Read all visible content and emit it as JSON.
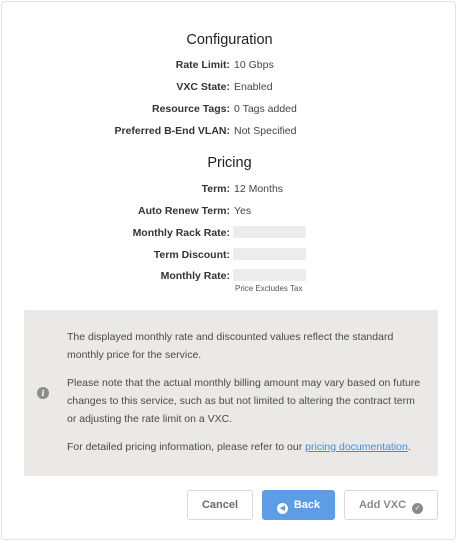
{
  "configuration": {
    "title": "Configuration",
    "rows": [
      {
        "label": "Rate Limit:",
        "value": "10 Gbps"
      },
      {
        "label": "VXC State:",
        "value": "Enabled"
      },
      {
        "label": "Resource Tags:",
        "value": "0 Tags added"
      },
      {
        "label": "Preferred B-End VLAN:",
        "value": "Not Specified"
      }
    ]
  },
  "pricing": {
    "title": "Pricing",
    "term_label": "Term:",
    "term_value": "12 Months",
    "auto_renew_label": "Auto Renew Term:",
    "auto_renew_value": "Yes",
    "monthly_rack_rate_label": "Monthly Rack Rate:",
    "term_discount_label": "Term Discount:",
    "monthly_rate_label": "Monthly Rate:",
    "tax_note": "Price Excludes Tax"
  },
  "info": {
    "paragraph1": "The displayed monthly rate and discounted values reflect the standard monthly price for the service.",
    "paragraph2": "Please note that the actual monthly billing amount may vary based on future changes to this service, such as but not limited to altering the contract term or adjusting the rate limit on a VXC.",
    "paragraph3_prefix": "For detailed pricing information, please refer to our ",
    "link_text": "pricing documentation",
    "paragraph3_suffix": "."
  },
  "buttons": {
    "cancel": "Cancel",
    "back": "Back",
    "add_vxc": "Add VXC"
  },
  "icons": {
    "info": "info-icon",
    "back": "arrow-left-circle-icon",
    "add": "check-circle-icon"
  },
  "colors": {
    "primary": "#5c9de6",
    "link": "#3d8fd8",
    "info_background": "#ebe9e8"
  }
}
